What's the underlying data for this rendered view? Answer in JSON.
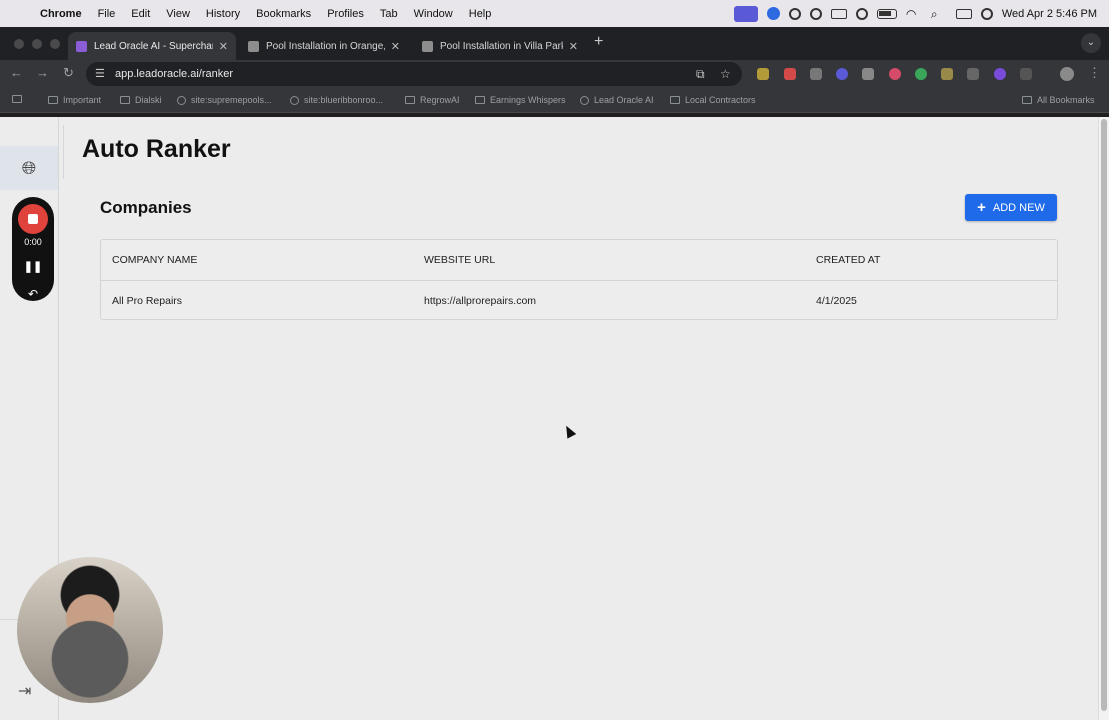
{
  "menubar": {
    "app_name": "Chrome",
    "items": [
      "File",
      "Edit",
      "View",
      "History",
      "Bookmarks",
      "Profiles",
      "Tab",
      "Window",
      "Help"
    ],
    "clock": "Wed Apr 2  5:46 PM"
  },
  "tabs": [
    {
      "title": "Lead Oracle AI - Supercharge",
      "favicon": "lead-oracle-logo",
      "active": true
    },
    {
      "title": "Pool Installation in Orange, C",
      "favicon": "cube-icon",
      "active": false
    },
    {
      "title": "Pool Installation in Villa Park,",
      "favicon": "cube-icon",
      "active": false
    }
  ],
  "toolbar": {
    "url": "app.leadoracle.ai/ranker"
  },
  "bookmarks": {
    "items": [
      "Important",
      "Dialski",
      "site:supremepools...",
      "site:blueribbonroo...",
      "RegrowAI",
      "Earnings Whispers",
      "Lead Oracle AI",
      "Local Contractors"
    ],
    "all_bookmarks": "All Bookmarks"
  },
  "page": {
    "title": "Auto Ranker",
    "section_title": "Companies",
    "add_button_label": "ADD NEW",
    "table": {
      "columns": [
        "COMPANY NAME",
        "WEBSITE URL",
        "CREATED AT"
      ],
      "rows": [
        {
          "company_name": "All Pro Repairs",
          "website_url": "https://allprorepairs.com",
          "created_at": "4/1/2025"
        }
      ]
    }
  },
  "recorder": {
    "time": "0:00"
  },
  "colors": {
    "accent": "#1f6ae8",
    "record": "#e0433b",
    "page_background": "#ececec"
  }
}
